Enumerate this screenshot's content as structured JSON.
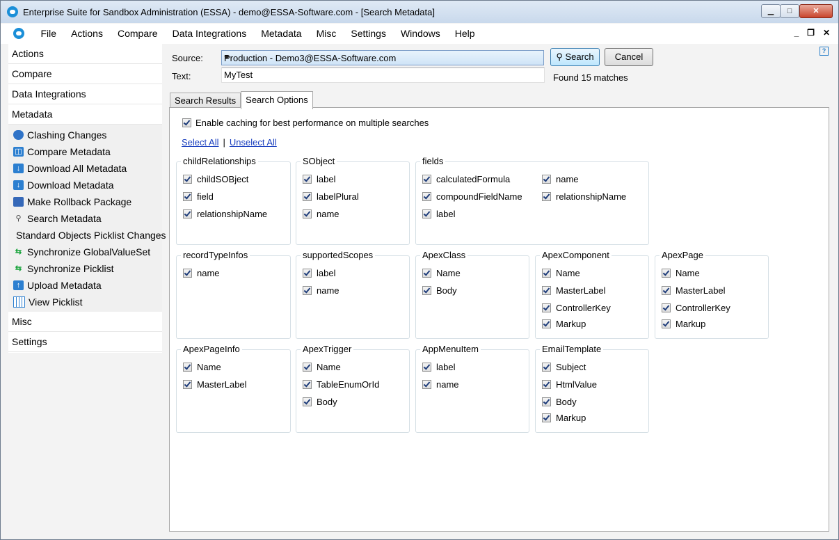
{
  "window": {
    "title": "Enterprise Suite for Sandbox Administration (ESSA) - demo@ESSA-Software.com - [Search Metadata]",
    "controls": {
      "minimize": "▁",
      "maximize": "□",
      "close": "✕"
    }
  },
  "menu": {
    "items": [
      "File",
      "Actions",
      "Compare",
      "Data Integrations",
      "Metadata",
      "Misc",
      "Settings",
      "Windows",
      "Help"
    ],
    "mdi": {
      "minimize": "_",
      "restore": "❐",
      "close": "✕"
    }
  },
  "sidebar": {
    "top": [
      "Actions",
      "Compare",
      "Data Integrations",
      "Metadata"
    ],
    "metadata_items": [
      {
        "label": "Clashing Changes",
        "icon": "shield-icon"
      },
      {
        "label": "Compare Metadata",
        "icon": "compare-icon"
      },
      {
        "label": "Download All Metadata",
        "icon": "download-icon"
      },
      {
        "label": "Download Metadata",
        "icon": "download-icon"
      },
      {
        "label": "Make Rollback Package",
        "icon": "package-icon"
      },
      {
        "label": "Search Metadata",
        "icon": "search-icon"
      },
      {
        "label": "Standard Objects Picklist Changes",
        "icon": ""
      },
      {
        "label": "Synchronize GlobalValueSet",
        "icon": "sync-icon"
      },
      {
        "label": "Synchronize Picklist",
        "icon": "sync-icon"
      },
      {
        "label": "Upload Metadata",
        "icon": "upload-icon"
      },
      {
        "label": "View Picklist",
        "icon": "grid-icon"
      }
    ],
    "bottom": [
      "Misc",
      "Settings"
    ]
  },
  "search": {
    "source_label": "Source:",
    "source_value": "Production - Demo3@ESSA-Software.com",
    "text_label": "Text:",
    "text_value": "MyTest",
    "search_button": "Search",
    "cancel_button": "Cancel",
    "status": "Found 15 matches",
    "help": "?"
  },
  "tabs": [
    "Search Results",
    "Search Options"
  ],
  "options": {
    "caching_label": "Enable caching for best performance on multiple searches",
    "select_all": "Select All",
    "separator": "|",
    "unselect_all": "Unselect All",
    "groups": [
      {
        "title": "childRelationships",
        "items": [
          "childSOBject",
          "field",
          "relationshipName"
        ]
      },
      {
        "title": "SObject",
        "items": [
          "label",
          "labelPlural",
          "name"
        ]
      },
      {
        "title": "fields",
        "items": [
          "calculatedFormula",
          "compoundFieldName",
          "label",
          "name",
          "relationshipName"
        ]
      },
      {
        "title": "recordTypeInfos",
        "items": [
          "name"
        ]
      },
      {
        "title": "supportedScopes",
        "items": [
          "label",
          "name"
        ]
      },
      {
        "title": "ApexClass",
        "items": [
          "Name",
          "Body"
        ]
      },
      {
        "title": "ApexComponent",
        "items": [
          "Name",
          "MasterLabel",
          "ControllerKey",
          "Markup"
        ]
      },
      {
        "title": "ApexPage",
        "items": [
          "Name",
          "MasterLabel",
          "ControllerKey",
          "Markup"
        ]
      },
      {
        "title": "ApexPageInfo",
        "items": [
          "Name",
          "MasterLabel"
        ]
      },
      {
        "title": "ApexTrigger",
        "items": [
          "Name",
          "TableEnumOrId",
          "Body"
        ]
      },
      {
        "title": "AppMenuItem",
        "items": [
          "label",
          "name"
        ]
      },
      {
        "title": "EmailTemplate",
        "items": [
          "Subject",
          "HtmlValue",
          "Body",
          "Markup"
        ]
      }
    ]
  }
}
